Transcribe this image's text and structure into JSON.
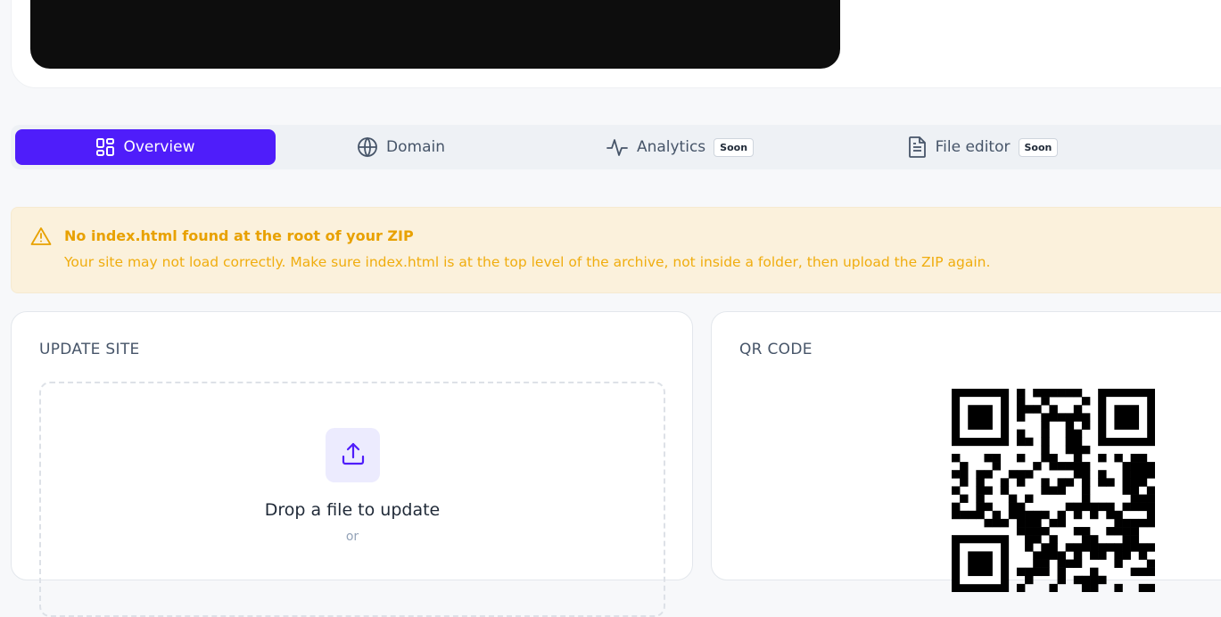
{
  "tabs": [
    {
      "label": "Overview",
      "icon": "layout-grid-icon",
      "active": true,
      "badge": ""
    },
    {
      "label": "Domain",
      "icon": "globe-icon",
      "active": false,
      "badge": ""
    },
    {
      "label": "Analytics",
      "icon": "activity-icon",
      "active": false,
      "badge": "Soon"
    },
    {
      "label": "File editor",
      "icon": "file-text-icon",
      "active": false,
      "badge": "Soon"
    }
  ],
  "alert": {
    "title": "No index.html found at the root of your ZIP",
    "message": "Your site may not load correctly. Make sure index.html is at the top level of the archive, not inside a folder, then upload the ZIP again.",
    "icon": "warning-icon"
  },
  "update_site": {
    "title": "UPDATE SITE",
    "drop_label": "Drop a file to update",
    "or_label": "or",
    "icon": "upload-icon"
  },
  "qr_code": {
    "title": "QR CODE"
  },
  "colors": {
    "accent": "#4f1dfa",
    "warning_text": "#e8a100",
    "warning_bg": "#fbf1dc"
  }
}
